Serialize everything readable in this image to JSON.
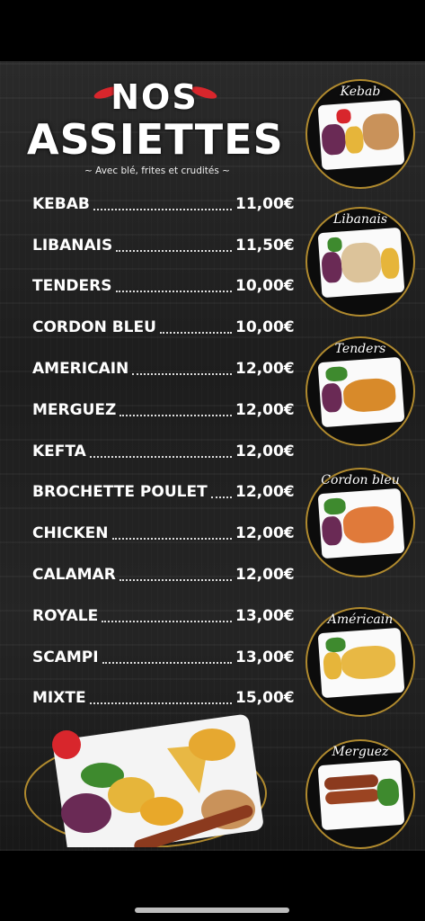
{
  "header": {
    "title_top": "NOS",
    "title_main": "ASSIETTES",
    "subtitle": "~ Avec blé, frites et crudités ~"
  },
  "menu": [
    {
      "name": "KEBAB",
      "price": "11,00€"
    },
    {
      "name": "LIBANAIS",
      "price": "11,50€"
    },
    {
      "name": "TENDERS",
      "price": "10,00€"
    },
    {
      "name": "CORDON BLEU",
      "price": "10,00€"
    },
    {
      "name": "AMERICAIN",
      "price": "12,00€"
    },
    {
      "name": "MERGUEZ",
      "price": "12,00€"
    },
    {
      "name": "KEFTA",
      "price": "12,00€"
    },
    {
      "name": "BROCHETTE POULET",
      "price": "12,00€"
    },
    {
      "name": "CHICKEN",
      "price": "12,00€"
    },
    {
      "name": "CALAMAR",
      "price": "12,00€"
    },
    {
      "name": "ROYALE",
      "price": "13,00€"
    },
    {
      "name": "SCAMPI",
      "price": "13,00€"
    },
    {
      "name": "MIXTE",
      "price": "15,00€"
    }
  ],
  "photos": [
    {
      "label": "Kebab"
    },
    {
      "label": "Libanais"
    },
    {
      "label": "Tenders"
    },
    {
      "label": "Cordon bleu"
    },
    {
      "label": "Américain"
    },
    {
      "label": "Merguez"
    }
  ],
  "colors": {
    "accent": "#d8262c",
    "gold": "#b08a2e",
    "text": "#ffffff"
  }
}
